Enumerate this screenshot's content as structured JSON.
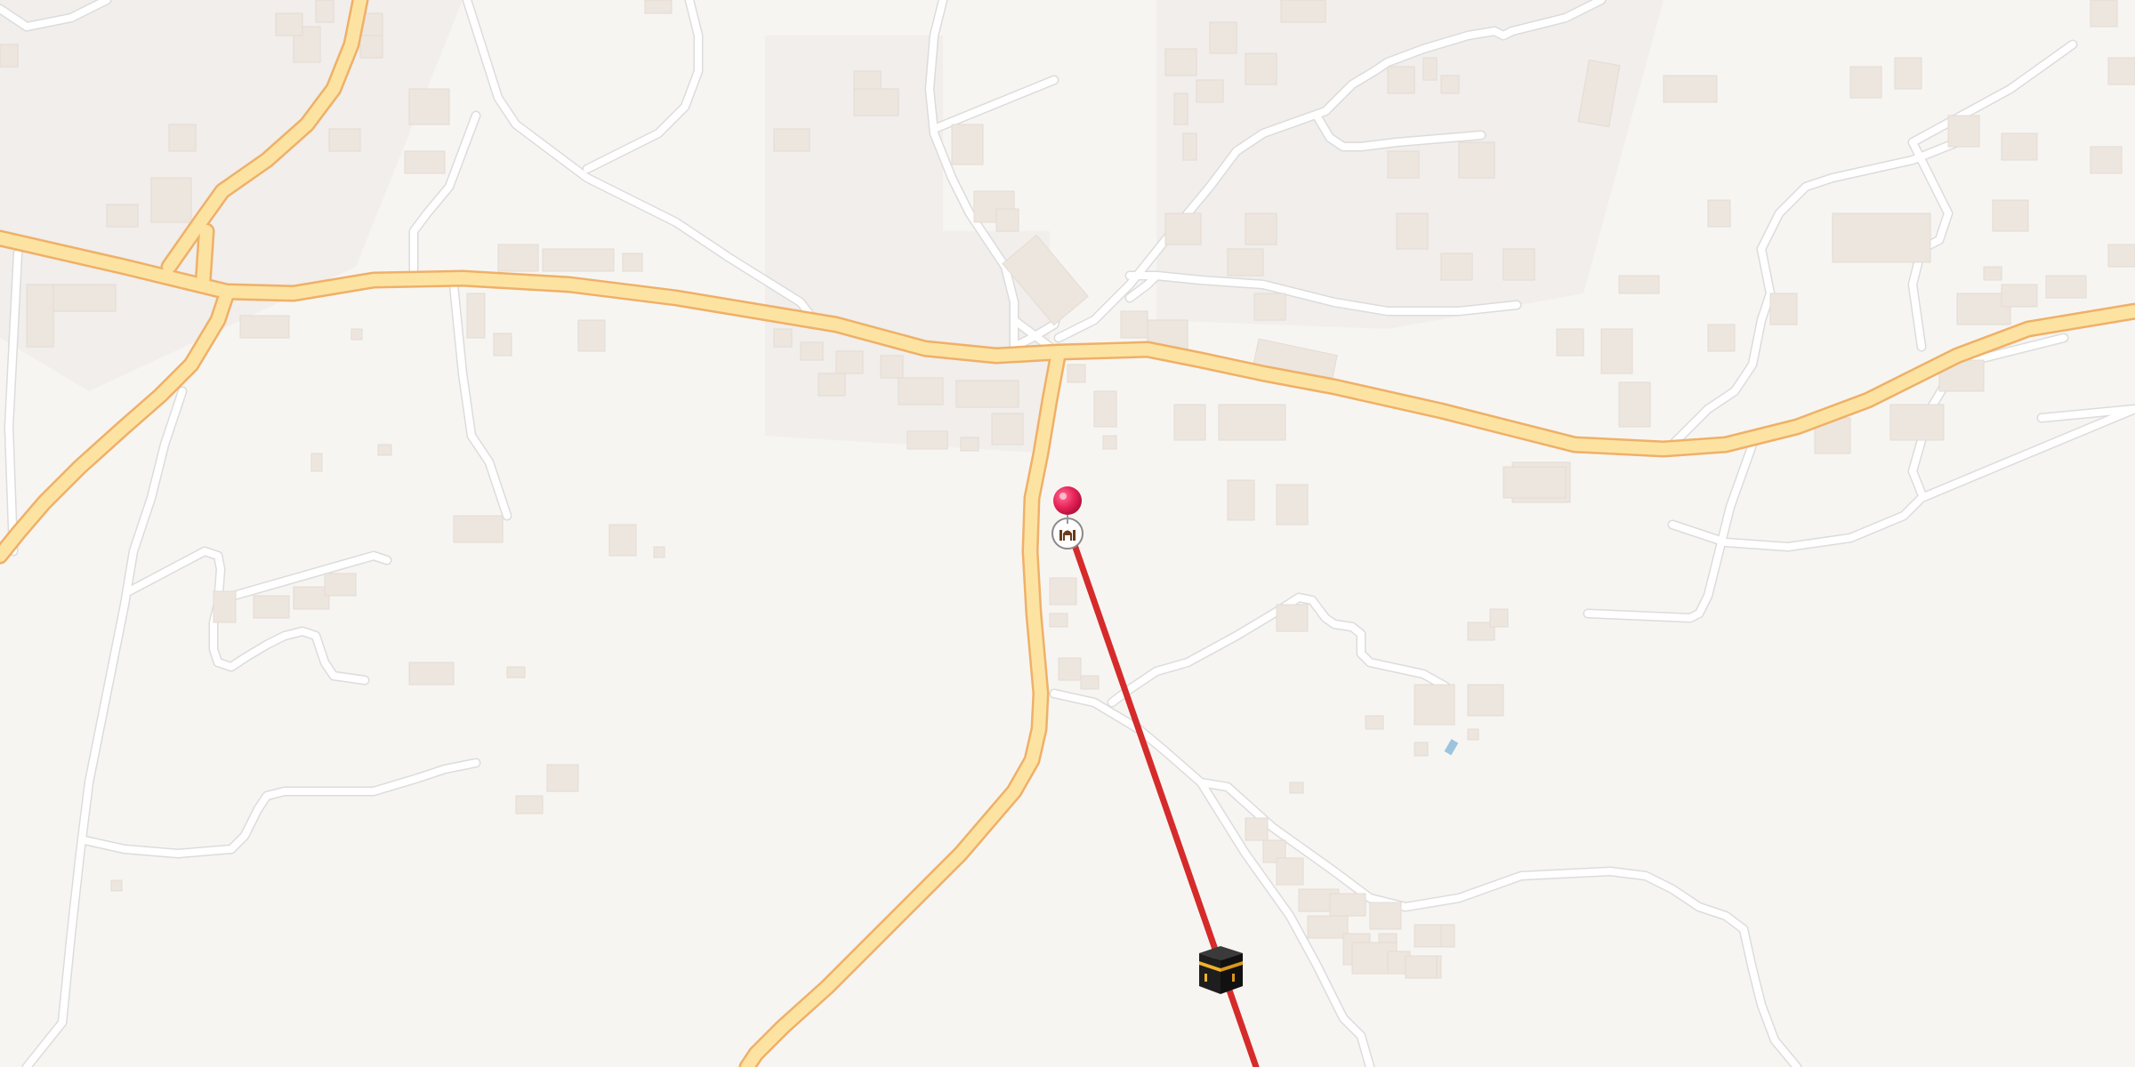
{
  "map": {
    "colors": {
      "background": "#f7f5f2",
      "major_road_fill": "#fde3a1",
      "major_road_casing": "#efb068",
      "minor_road": "#ffffff",
      "building": "#ede6df",
      "qibla_line": "#d52b2b",
      "pin": "#e8245a"
    },
    "markers": [
      {
        "name": "location-pin",
        "icon": "map-pin-icon"
      },
      {
        "name": "mosque-poi",
        "icon": "mosque-icon"
      },
      {
        "name": "kaaba-marker",
        "icon": "kaaba-icon"
      }
    ],
    "line": {
      "name": "qibla-direction-line"
    }
  }
}
